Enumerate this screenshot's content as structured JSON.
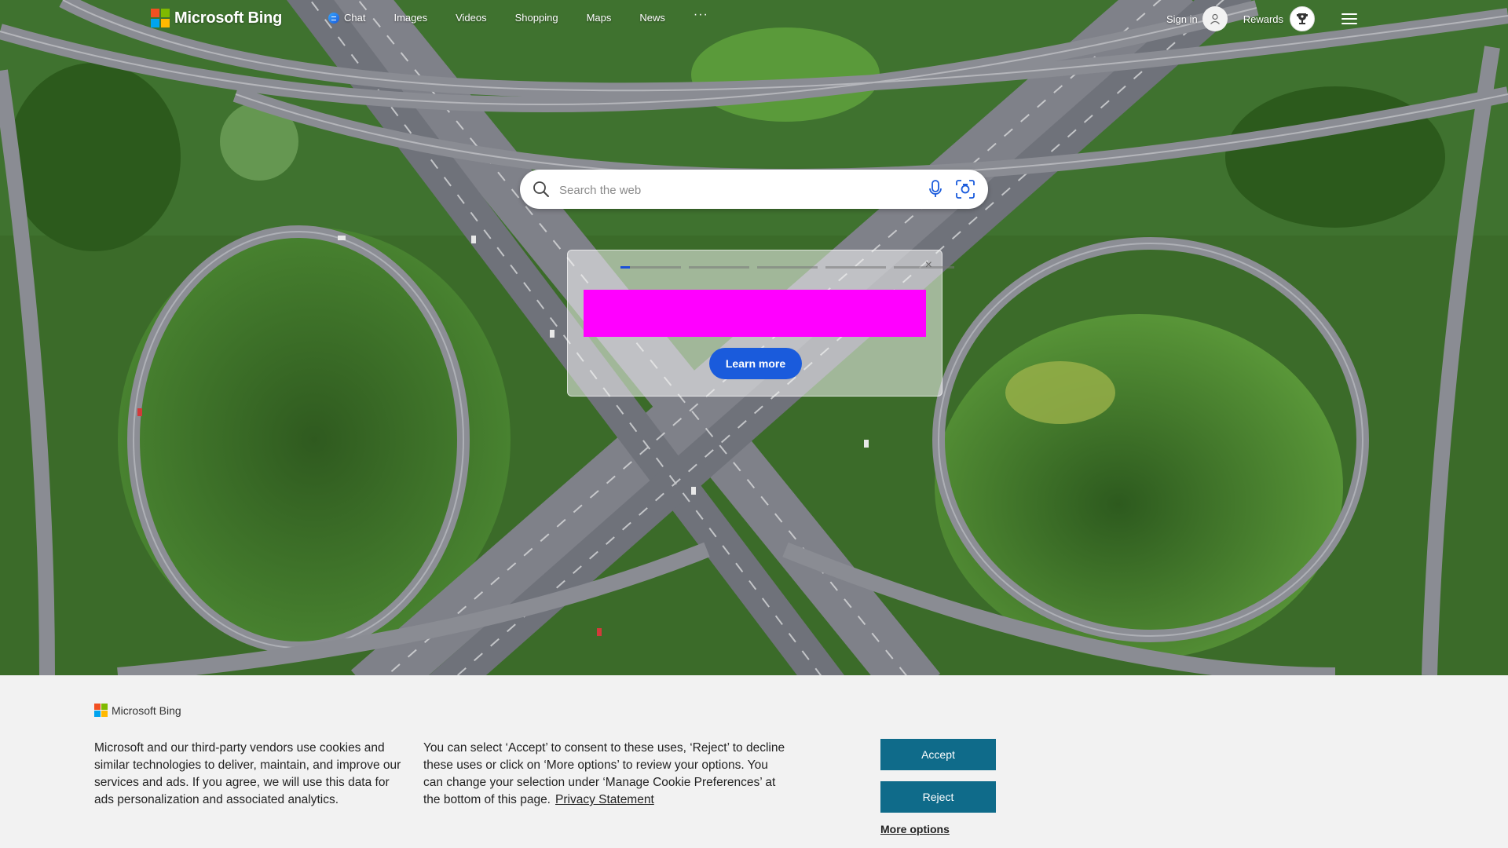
{
  "brand": {
    "name": "Microsoft Bing",
    "colors": {
      "red": "#f25022",
      "green": "#7fba00",
      "blue": "#00a4ef",
      "yellow": "#ffb900"
    }
  },
  "nav": {
    "items": [
      {
        "label": "Chat",
        "icon": "copilot-chat-icon"
      },
      {
        "label": "Images"
      },
      {
        "label": "Videos"
      },
      {
        "label": "Shopping"
      },
      {
        "label": "Maps"
      },
      {
        "label": "News"
      }
    ],
    "more": "···"
  },
  "account": {
    "signin_label": "Sign in",
    "rewards_label": "Rewards"
  },
  "search": {
    "placeholder": "Search the web",
    "value": ""
  },
  "promo": {
    "pager_count": 5,
    "active_index": 0,
    "button_label": "Learn more",
    "close": "×",
    "banner_color": "#ff00ff"
  },
  "cookie": {
    "brand": "Microsoft Bing",
    "paragraph1": "Microsoft and our third-party vendors use cookies and similar technologies to deliver, maintain, and improve our services and ads. If you agree, we will use this data for ads personalization and associated analytics.",
    "paragraph2": "You can select ‘Accept’ to consent to these uses, ‘Reject’ to decline these uses or click on ‘More options’ to review your options. You can change your selection under ‘Manage Cookie Preferences’ at the bottom of this page.",
    "privacy_link": "Privacy Statement",
    "accept_label": "Accept",
    "reject_label": "Reject",
    "more_options_label": "More options",
    "button_color": "#0f6b8a"
  }
}
